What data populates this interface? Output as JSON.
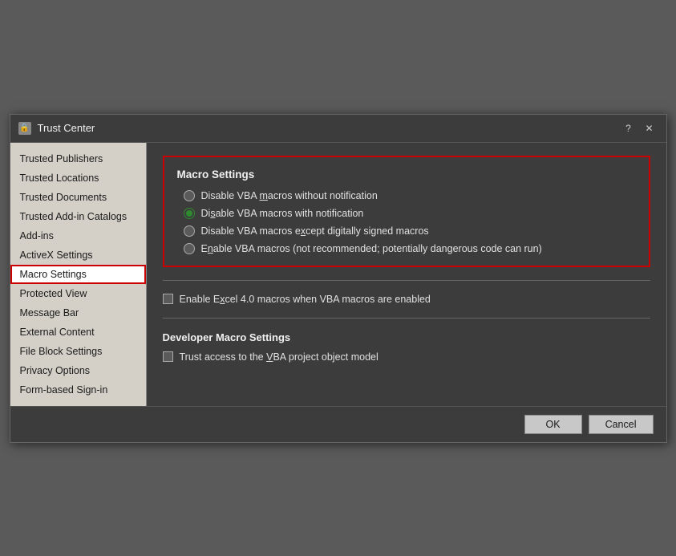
{
  "dialog": {
    "title": "Trust Center",
    "title_icon": "⚙",
    "help_label": "?",
    "close_label": "✕"
  },
  "sidebar": {
    "items": [
      {
        "id": "trusted-publishers",
        "label": "Trusted Publishers",
        "active": false
      },
      {
        "id": "trusted-locations",
        "label": "Trusted Locations",
        "active": false
      },
      {
        "id": "trusted-documents",
        "label": "Trusted Documents",
        "active": false
      },
      {
        "id": "trusted-add-in-catalogs",
        "label": "Trusted Add-in Catalogs",
        "active": false
      },
      {
        "id": "add-ins",
        "label": "Add-ins",
        "active": false
      },
      {
        "id": "activex-settings",
        "label": "ActiveX Settings",
        "active": false
      },
      {
        "id": "macro-settings",
        "label": "Macro Settings",
        "active": true
      },
      {
        "id": "protected-view",
        "label": "Protected View",
        "active": false
      },
      {
        "id": "message-bar",
        "label": "Message Bar",
        "active": false
      },
      {
        "id": "external-content",
        "label": "External Content",
        "active": false
      },
      {
        "id": "file-block-settings",
        "label": "File Block Settings",
        "active": false
      },
      {
        "id": "privacy-options",
        "label": "Privacy Options",
        "active": false
      },
      {
        "id": "form-based-sign-in",
        "label": "Form-based Sign-in",
        "active": false
      }
    ]
  },
  "content": {
    "macro_settings_title": "Macro Settings",
    "radio_options": [
      {
        "id": "disable-no-notify",
        "label": "Disable VBA macros without notification",
        "selected": false
      },
      {
        "id": "disable-notify",
        "label": "Disable VBA macros with notification",
        "selected": true
      },
      {
        "id": "disable-except-signed",
        "label": "Disable VBA macros except digitally signed macros",
        "selected": false
      },
      {
        "id": "enable-all",
        "label": "Enable VBA macros (not recommended; potentially dangerous code can run)",
        "selected": false
      }
    ],
    "excel_macro_label": "Enable Excel 4.0 macros when VBA macros are enabled",
    "excel_macro_checked": false,
    "developer_title": "Developer Macro Settings",
    "vba_access_label": "Trust access to the VBA project object model",
    "vba_access_checked": false,
    "underline_chars": {
      "macros": "m",
      "disable_vba_with": "s",
      "except": "x",
      "enable": "n",
      "excel": "x",
      "vba_project": "V"
    }
  },
  "footer": {
    "ok_label": "OK",
    "cancel_label": "Cancel"
  }
}
